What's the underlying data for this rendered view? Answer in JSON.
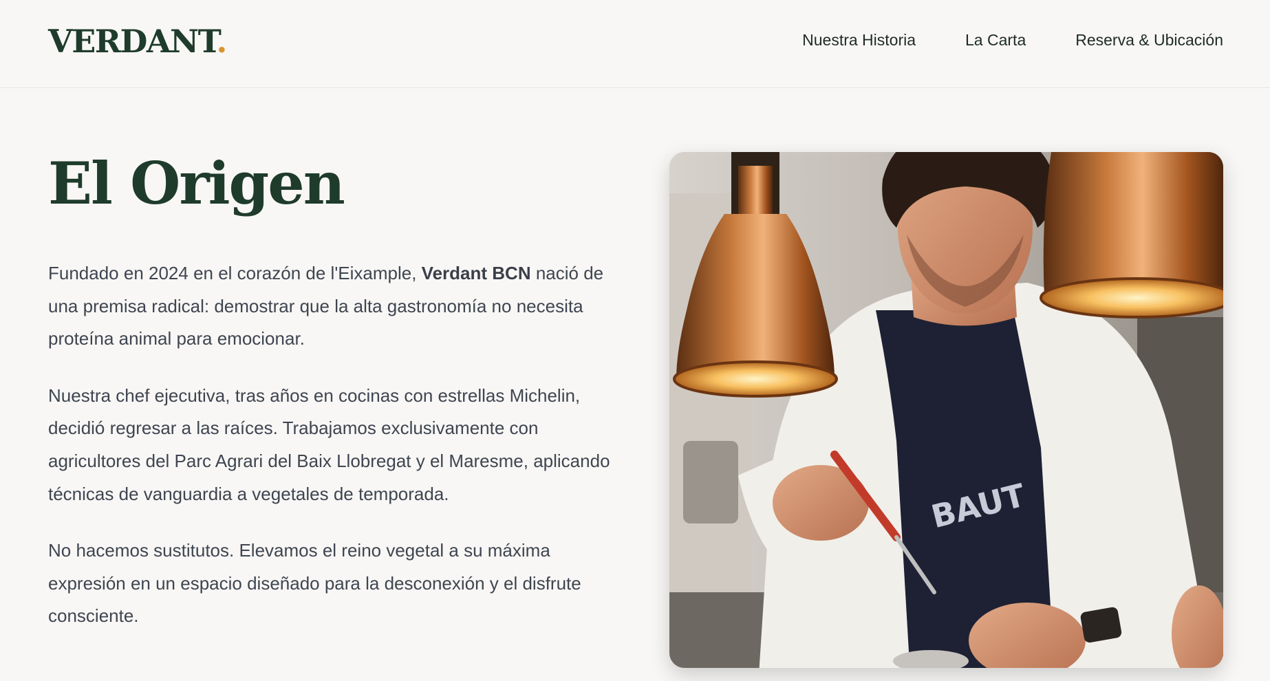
{
  "brand": {
    "name": "VERDANT",
    "dot": "."
  },
  "nav": {
    "items": [
      {
        "label": "Nuestra Historia"
      },
      {
        "label": "La Carta"
      },
      {
        "label": "Reserva & Ubicación"
      }
    ]
  },
  "section": {
    "title": "El Origen",
    "p1_before": "Fundado en 2024 en el corazón de l'Eixample, ",
    "p1_strong": "Verdant BCN",
    "p1_after": " nació de una premisa radical: demostrar que la alta gastronomía no necesita proteína animal para emocionar.",
    "p2": "Nuestra chef ejecutiva, tras años en cocinas con estrellas Michelin, decidió regresar a las raíces. Trabajamos exclusivamente con agricultores del Parc Agrari del Baix Llobregat y el Maresme, aplicando técnicas de vanguardia a vegetales de temporada.",
    "p3": "No hacemos sustitutos. Elevamos el reino vegetal a su máxima expresión en un espacio diseñado para la desconexión y el disfrute consciente."
  },
  "photo": {
    "apron_text": "BAUT"
  },
  "colors": {
    "background": "#f8f7f5",
    "brand_green": "#1f3b2b",
    "accent_orange": "#d8952e",
    "body_text": "#3f4550"
  }
}
